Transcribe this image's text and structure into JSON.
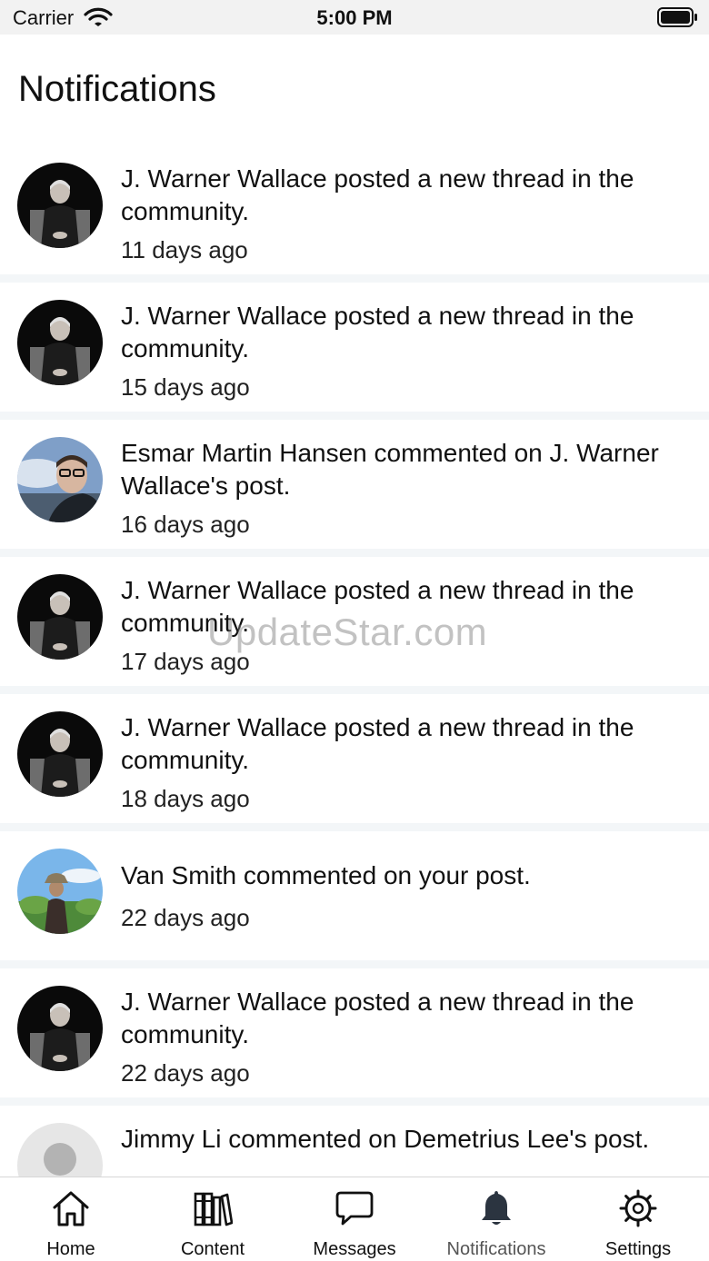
{
  "status_bar": {
    "carrier": "Carrier",
    "time": "5:00 PM"
  },
  "page": {
    "title": "Notifications"
  },
  "notifications": [
    {
      "text": "J. Warner Wallace posted a new thread in the community.",
      "time": "11 days ago",
      "avatar": "person-portrait-dark"
    },
    {
      "text": "J. Warner Wallace posted a new thread in the community.",
      "time": "15 days ago",
      "avatar": "person-portrait-dark"
    },
    {
      "text": "Esmar Martin Hansen commented on J. Warner Wallace's post.",
      "time": "16 days ago",
      "avatar": "person-selfie-sky"
    },
    {
      "text": "J. Warner Wallace posted a new thread in the community.",
      "time": "17 days ago",
      "avatar": "person-portrait-dark"
    },
    {
      "text": "J. Warner Wallace posted a new thread in the community.",
      "time": "18 days ago",
      "avatar": "person-portrait-dark"
    },
    {
      "text": "Van Smith commented on your post.",
      "time": "22 days ago",
      "avatar": "person-outdoor-hat"
    },
    {
      "text": "J. Warner Wallace posted a new thread in the community.",
      "time": "22 days ago",
      "avatar": "person-portrait-dark"
    },
    {
      "text": "Jimmy Li commented on Demetrius Lee's post.",
      "time": "",
      "avatar": "placeholder-avatar"
    }
  ],
  "watermark": "UpdateStar.com",
  "tab_bar": {
    "tabs": [
      {
        "label": "Home",
        "icon": "home-icon"
      },
      {
        "label": "Content",
        "icon": "books-icon"
      },
      {
        "label": "Messages",
        "icon": "chat-bubble-icon"
      },
      {
        "label": "Notifications",
        "icon": "bell-icon",
        "active": true
      },
      {
        "label": "Settings",
        "icon": "gear-icon"
      }
    ]
  },
  "colors": {
    "background": "#ffffff",
    "divider": "#f3f6f8",
    "active_tab_icon": "#2b3440",
    "text": "#111111"
  }
}
